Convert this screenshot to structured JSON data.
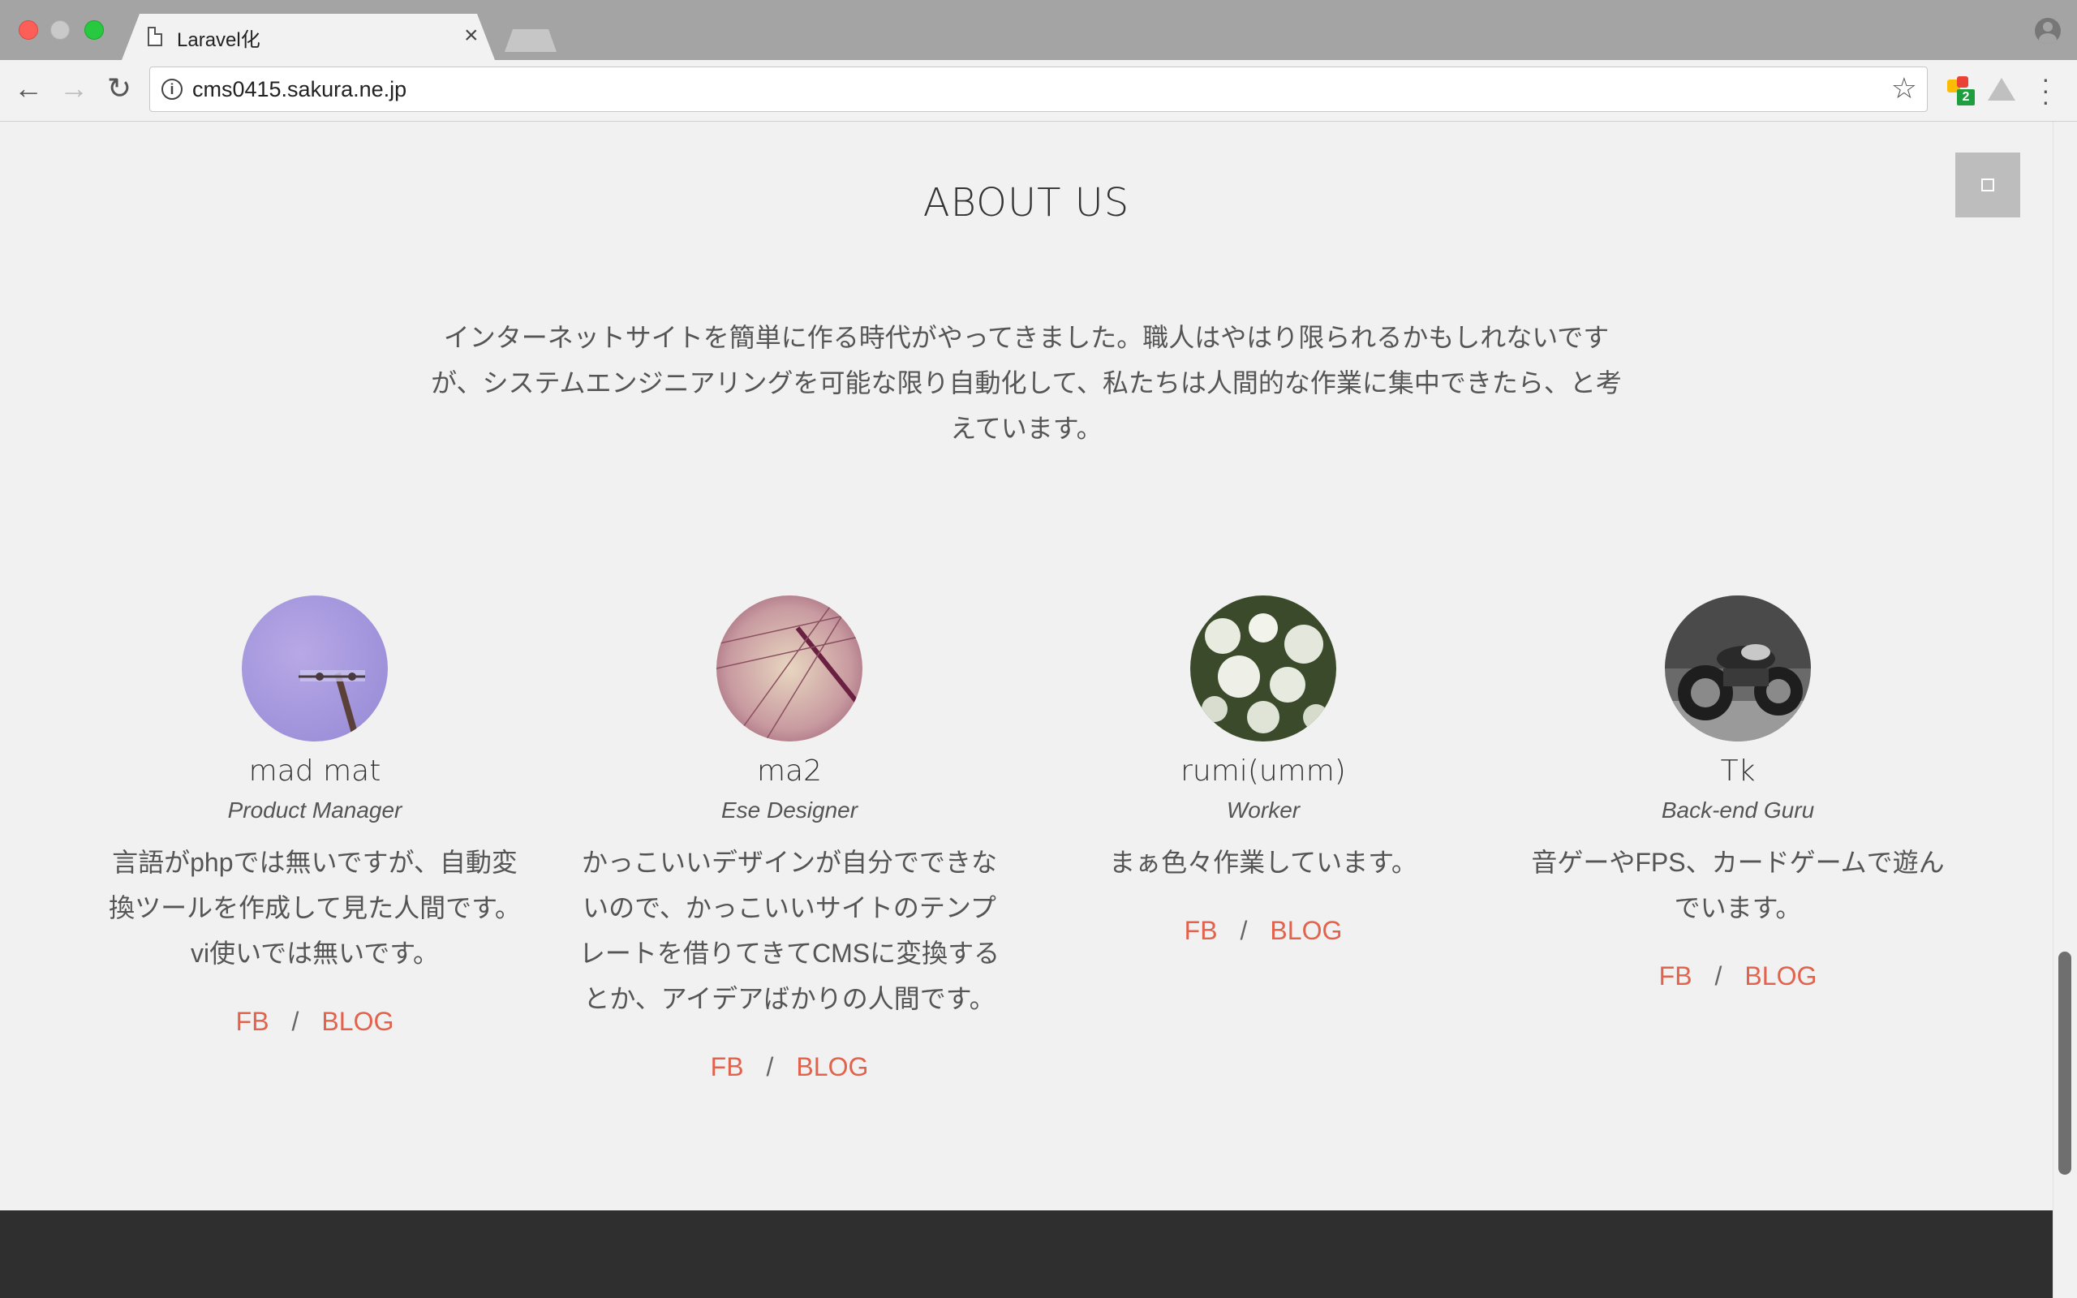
{
  "browser": {
    "tab_title": "Laravel化",
    "tab_close": "×",
    "url": "cms0415.sakura.ne.jp",
    "extension_badge": "2"
  },
  "about": {
    "title": "ABOUT US",
    "intro": "インターネットサイトを簡単に作る時代がやってきました。職人はやはり限られるかもしれないですが、システムエンジニアリングを可能な限り自動化して、私たちは人間的な作業に集中できたら、と考えています。"
  },
  "members": [
    {
      "name": "mad mat",
      "role": "Product Manager",
      "bio": "言語がphpでは無いですが、自動変換ツールを作成して見た人間です。vi使いでは無いです。",
      "fb": "FB",
      "sep": "/",
      "blog": "BLOG"
    },
    {
      "name": "ma2",
      "role": "Ese Designer",
      "bio": "かっこいいデザインが自分でできないので、かっこいいサイトのテンプレートを借りてきてCMSに変換するとか、アイデアばかりの人間です。",
      "fb": "FB",
      "sep": "/",
      "blog": "BLOG"
    },
    {
      "name": "rumi(umm)",
      "role": "Worker",
      "bio": "まぁ色々作業しています。",
      "fb": "FB",
      "sep": "/",
      "blog": "BLOG"
    },
    {
      "name": "Tk",
      "role": "Back-end Guru",
      "bio": "音ゲーやFPS、カードゲームで遊んでいます。",
      "fb": "FB",
      "sep": "/",
      "blog": "BLOG"
    }
  ],
  "colors": {
    "link": "#e2624c",
    "footer": "#2f2f2f",
    "background": "#f1f1f1"
  },
  "icons": [
    "page-icon",
    "back-icon",
    "forward-icon",
    "reload-icon",
    "info-icon",
    "star-icon",
    "extension-icon",
    "drive-icon",
    "menu-icon",
    "profile-icon",
    "menu-toggle-icon"
  ]
}
